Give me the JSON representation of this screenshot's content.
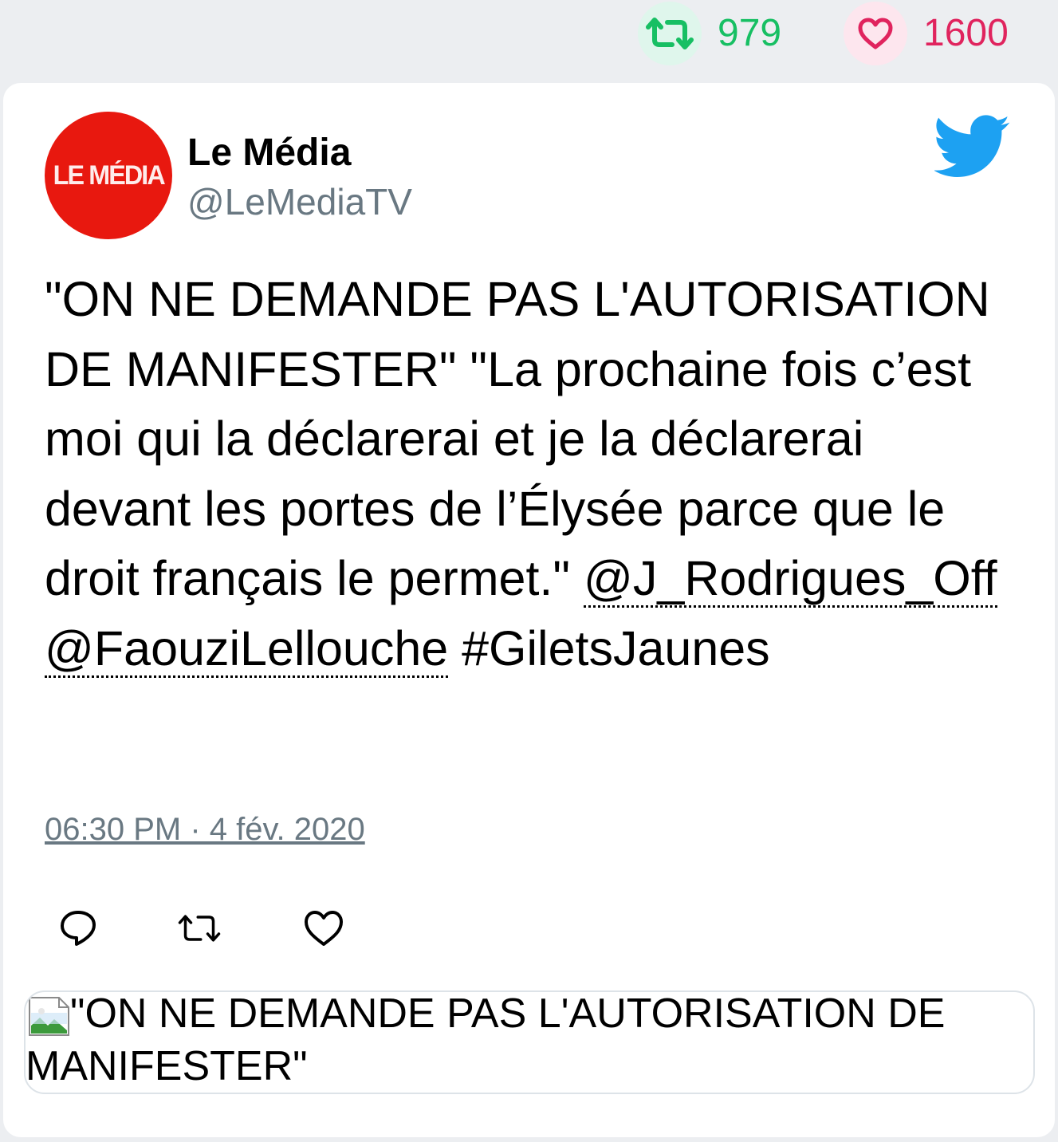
{
  "stats": {
    "retweets": "979",
    "likes": "1600",
    "retweet_color": "#17bf63",
    "like_color": "#e0245e"
  },
  "author": {
    "avatar_text": "LE MÉDIA",
    "name": "Le Média",
    "handle": "@LeMediaTV",
    "avatar_color": "#e8180f"
  },
  "tweet": {
    "text_part1": "\"ON NE DEMANDE PAS L'AUTORISATION DE MANIFESTER\" \"La prochaine fois c’est moi qui la déclarerai et je la déclarerai devant les portes de l’Élysée parce que le droit français le permet.\" ",
    "mention1": "@J_Rodrigues_Off",
    "mention2": "@FaouziLellouche",
    "hashtag": " #GiletsJaunes",
    "timestamp": "06:30 PM · 4 fév. 2020"
  },
  "icons": {
    "brand": "twitter-bird-icon",
    "reply": "reply-icon",
    "retweet": "retweet-icon",
    "like": "heart-icon",
    "preview": "broken-image-icon"
  },
  "preview": {
    "text": "\"ON NE DEMANDE PAS L'AUTORISATION DE MANIFESTER\""
  }
}
